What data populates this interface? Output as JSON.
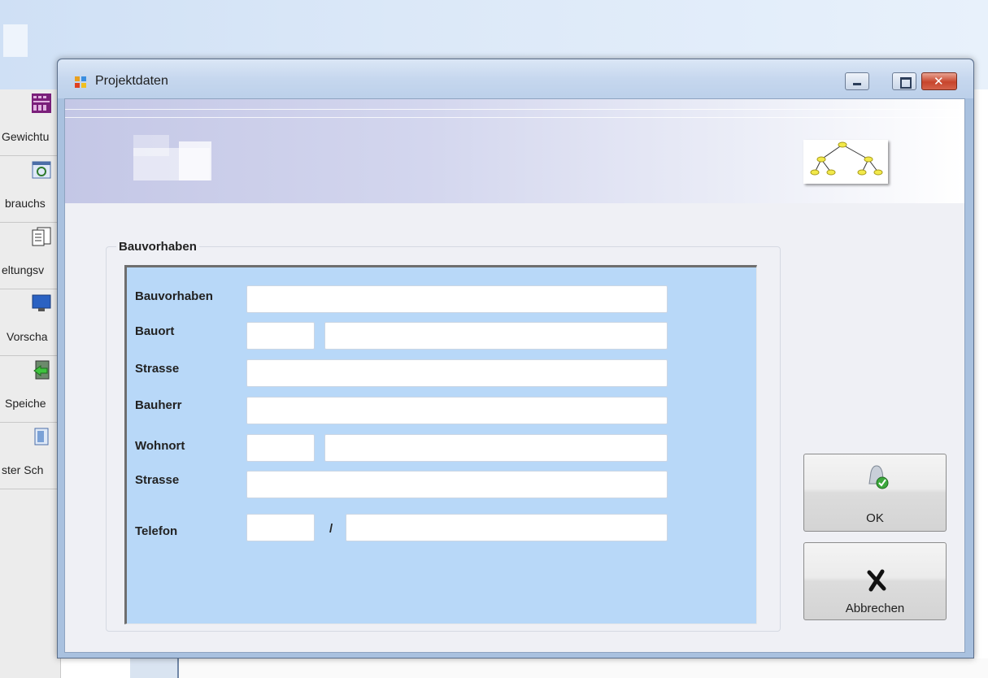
{
  "dialog": {
    "title": "Projektdaten"
  },
  "sidebar": {
    "items": [
      {
        "label": "Gewichtu",
        "icon": "grid-icon"
      },
      {
        "label": "brauchs",
        "icon": "refresh-icon"
      },
      {
        "label": "eltungsv",
        "icon": "document-icon"
      },
      {
        "label": "Vorscha",
        "icon": "monitor-icon"
      },
      {
        "label": "Speiche",
        "icon": "save-arrow-icon"
      },
      {
        "label": "ster Sch",
        "icon": "door-icon"
      }
    ]
  },
  "form": {
    "group_title": "Bauvorhaben",
    "labels": {
      "bauvorhaben": "Bauvorhaben",
      "bauort": "Bauort",
      "strasse1": "Strasse",
      "bauherr": "Bauherr",
      "wohnort": "Wohnort",
      "strasse2": "Strasse",
      "telefon": "Telefon",
      "separator": "/"
    },
    "values": {
      "bauvorhaben": "",
      "bauort_plz": "",
      "bauort_ort": "",
      "strasse1": "",
      "bauherr": "",
      "wohnort_plz": "",
      "wohnort_ort": "",
      "strasse2": "",
      "telefon_vorwahl": "",
      "telefon_nummer": ""
    }
  },
  "buttons": {
    "ok": "OK",
    "cancel": "Abbrechen"
  },
  "colors": {
    "panel_bg": "#b8d8f8",
    "titlebar": "#c6d7ee",
    "close_button": "#c7452c"
  }
}
